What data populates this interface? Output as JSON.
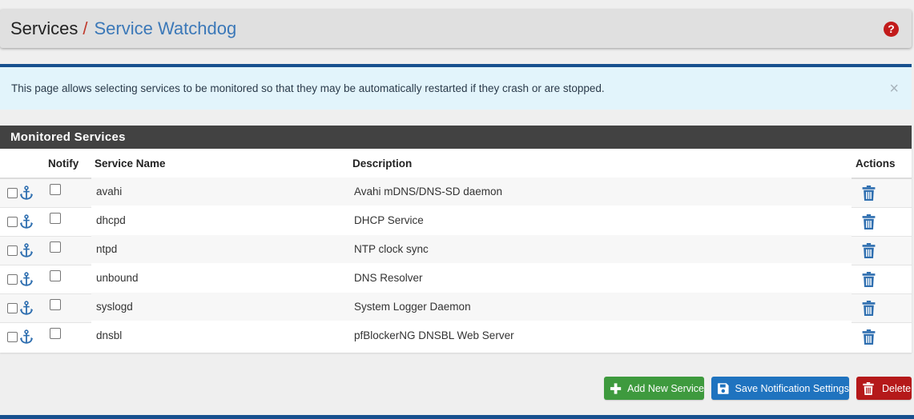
{
  "header": {
    "breadcrumb_root": "Services",
    "breadcrumb_sep": "/",
    "breadcrumb_page": "Service Watchdog",
    "help_glyph": "?"
  },
  "alert": {
    "text": "This page allows selecting services to be monitored so that they may be automatically restarted if they crash or are stopped.",
    "close_glyph": "×"
  },
  "panel": {
    "title": "Monitored Services",
    "columns": {
      "notify": "Notify",
      "name": "Service Name",
      "description": "Description",
      "actions": "Actions"
    },
    "rows": [
      {
        "name": "avahi",
        "description": "Avahi mDNS/DNS-SD daemon"
      },
      {
        "name": "dhcpd",
        "description": "DHCP Service"
      },
      {
        "name": "ntpd",
        "description": "NTP clock sync"
      },
      {
        "name": "unbound",
        "description": "DNS Resolver"
      },
      {
        "name": "syslogd",
        "description": "System Logger Daemon"
      },
      {
        "name": "dnsbl",
        "description": "pfBlockerNG DNSBL Web Server"
      }
    ]
  },
  "buttons": {
    "add": "Add New Service",
    "save": "Save Notification Settings",
    "delete": "Delete"
  },
  "colors": {
    "link_blue": "#3b78b8",
    "panel_heading": "#424242",
    "success": "#3e9a3e",
    "primary": "#1f73bf",
    "danger": "#b5191a"
  }
}
